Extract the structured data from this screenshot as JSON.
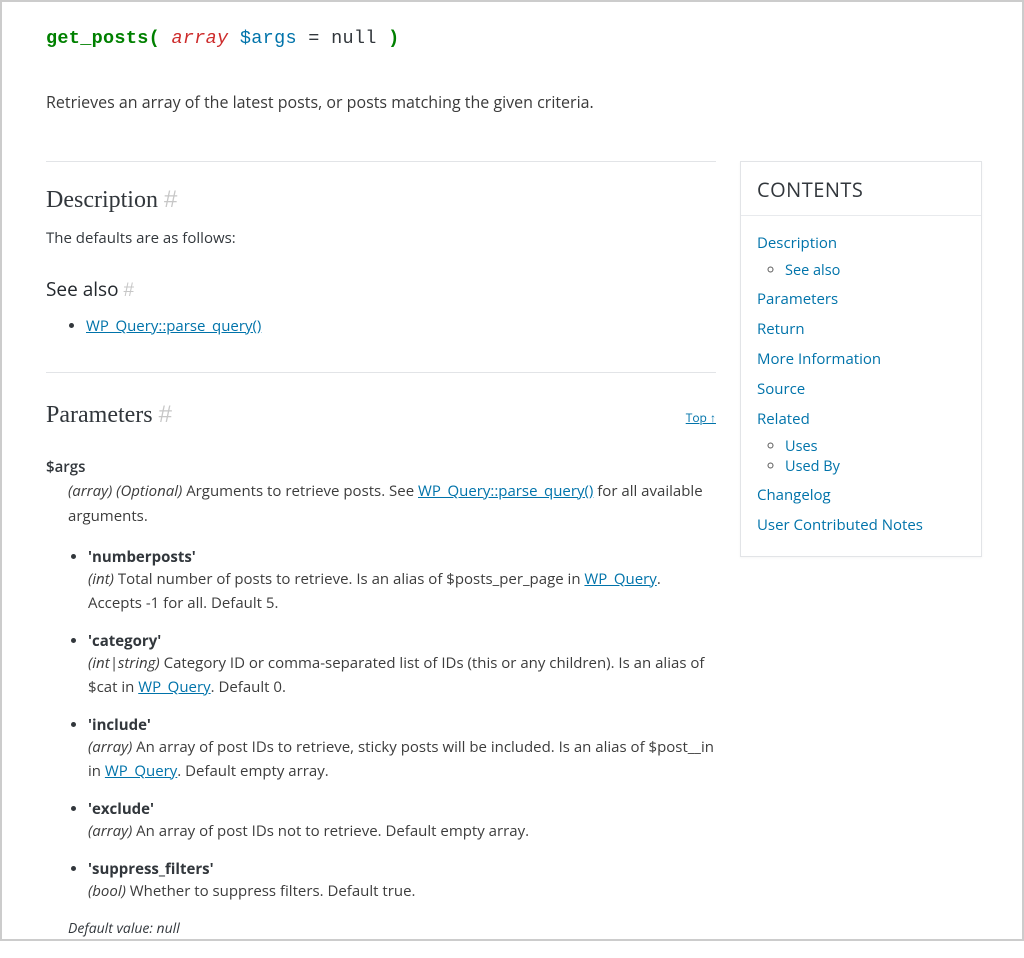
{
  "signature": {
    "fn": "get_posts",
    "open": "(",
    "type": "array",
    "var": "$args",
    "eq": "=",
    "nullv": "null",
    "close": ")"
  },
  "summary": "Retrieves an array of the latest posts, or posts matching the given criteria.",
  "sections": {
    "description": {
      "title": "Description",
      "hash": "#",
      "text": "The defaults are as follows:"
    },
    "see_also": {
      "title": "See also",
      "hash": "#",
      "link": "WP_Query::parse_query()"
    },
    "parameters": {
      "title": "Parameters",
      "hash": "#",
      "top": "Top ↑"
    }
  },
  "args": {
    "name": "$args",
    "type": "(array)",
    "optional": "(Optional)",
    "desc_pre": "Arguments to retrieve posts. See ",
    "desc_link": "WP_Query::parse_query()",
    "desc_post": " for all available arguments.",
    "default_label": "Default value: null"
  },
  "params": [
    {
      "key": "'numberposts'",
      "type": "(int)",
      "pre": " Total number of posts to retrieve. Is an alias of $posts_per_page in ",
      "link": "WP_Query",
      "post": ". Accepts -1 for all. Default 5."
    },
    {
      "key": "'category'",
      "type": "(int|string)",
      "pre": " Category ID or comma-separated list of IDs (this or any children). Is an alias of $cat in ",
      "link": "WP_Query",
      "post": ". Default 0."
    },
    {
      "key": "'include'",
      "type": "(array)",
      "pre": " An array of post IDs to retrieve, sticky posts will be included. Is an alias of $post__in in ",
      "link": "WP_Query",
      "post": ". Default empty array."
    },
    {
      "key": "'exclude'",
      "type": "(array)",
      "pre": " An array of post IDs not to retrieve. Default empty array.",
      "link": "",
      "post": ""
    },
    {
      "key": "'suppress_filters'",
      "type": "(bool)",
      "pre": " Whether to suppress filters. Default true.",
      "link": "",
      "post": ""
    }
  ],
  "toc": {
    "title": "CONTENTS",
    "items": [
      {
        "label": "Description",
        "children": [
          {
            "label": "See also"
          }
        ]
      },
      {
        "label": "Parameters"
      },
      {
        "label": "Return"
      },
      {
        "label": "More Information"
      },
      {
        "label": "Source"
      },
      {
        "label": "Related",
        "children": [
          {
            "label": "Uses"
          },
          {
            "label": "Used By"
          }
        ]
      },
      {
        "label": "Changelog"
      },
      {
        "label": "User Contributed Notes"
      }
    ]
  }
}
